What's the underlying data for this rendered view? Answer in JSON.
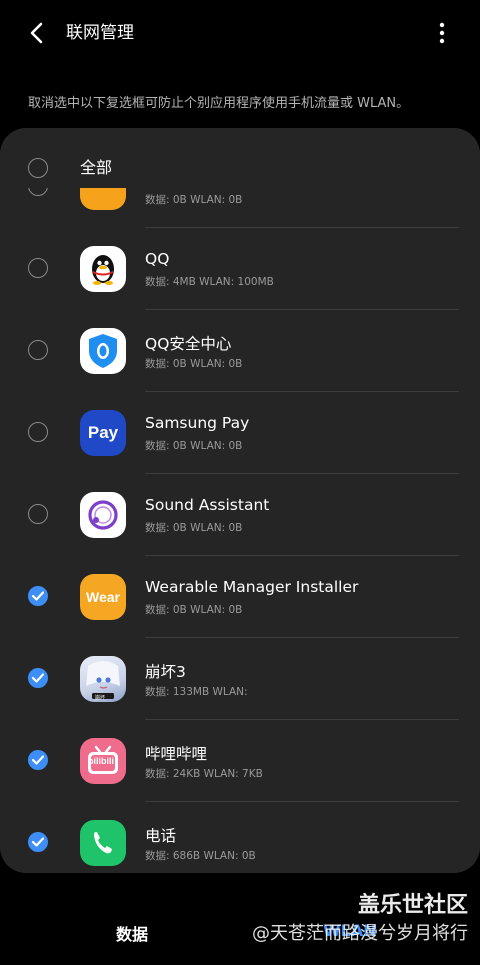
{
  "header": {
    "title": "联网管理"
  },
  "description": "取消选中以下复选框可防止个别应用程序使用手机流量或 WLAN。",
  "select_all": {
    "label": "全部",
    "checked": false
  },
  "apps": [
    {
      "name": "",
      "usage": "数据: 0B  WLAN: 0B",
      "checked": false,
      "icon": "orange-app-icon",
      "icon_color": "#f7a21b"
    },
    {
      "name": "QQ",
      "usage": "数据: 4MB  WLAN: 100MB",
      "checked": false,
      "icon": "qq-penguin-icon",
      "icon_color": "#ffffff"
    },
    {
      "name": "QQ安全中心",
      "usage": "数据: 0B  WLAN: 0B",
      "checked": false,
      "icon": "qq-security-shield-icon",
      "icon_color": "#1e8ef0"
    },
    {
      "name": "Samsung Pay",
      "usage": "数据: 0B  WLAN: 0B",
      "checked": false,
      "icon": "samsung-pay-icon",
      "icon_color": "#1f49c7",
      "icon_text": "Pay"
    },
    {
      "name": "Sound Assistant",
      "usage": "数据: 0B  WLAN: 0B",
      "checked": false,
      "icon": "sound-assistant-icon",
      "icon_color": "#7b3fc9"
    },
    {
      "name": "Wearable Manager Installer",
      "usage": "数据: 0B  WLAN: 0B",
      "checked": true,
      "icon": "wear-icon",
      "icon_color": "#f5a623",
      "icon_text": "Wear"
    },
    {
      "name": "崩坏3",
      "usage": "数据: 133MB  WLAN:",
      "checked": true,
      "icon": "honkai-impact-icon",
      "icon_color": "#c9d3e8",
      "icon_text": "崩坏"
    },
    {
      "name": "哔哩哔哩",
      "usage": "数据: 24KB  WLAN: 7KB",
      "checked": true,
      "icon": "bilibili-icon",
      "icon_color": "#f06c8c",
      "icon_text": "bilibili"
    },
    {
      "name": "电话",
      "usage": "数据: 686B  WLAN: 0B",
      "checked": true,
      "icon": "phone-icon",
      "icon_color": "#1fc36a"
    }
  ],
  "tabs": {
    "data": "数据",
    "wlan": "WLAN"
  },
  "watermark": {
    "line1": "盖乐世社区",
    "line2": "@天苍茫而路漫兮岁月将行"
  },
  "colors": {
    "accent": "#3e8ef7",
    "card": "#252525",
    "background": "#000000"
  }
}
